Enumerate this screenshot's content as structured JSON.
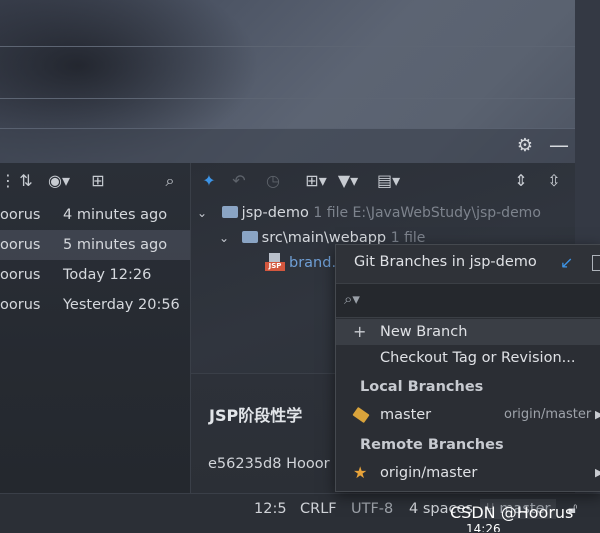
{
  "log": {
    "rows": [
      {
        "author": "oorus",
        "time": "4 minutes ago",
        "selected": false
      },
      {
        "author": "oorus",
        "time": "5 minutes ago",
        "selected": true
      },
      {
        "author": "oorus",
        "time": "Today 12:26",
        "selected": false
      },
      {
        "author": "oorus",
        "time": "Yesterday 20:56",
        "selected": false
      }
    ]
  },
  "changes": {
    "project": "jsp-demo",
    "project_meta": "1 file  E:\\JavaWebStudy\\jsp-demo",
    "folder": "src\\main\\webapp",
    "folder_meta": "1 file",
    "file": "brand.",
    "commit_title": "JSP阶段性学",
    "commit_hash": "e56235d8 Hooor"
  },
  "popup": {
    "title": "Git Branches in jsp-demo",
    "search_placeholder": "",
    "new_branch": "New Branch",
    "checkout": "Checkout Tag or Revision...",
    "local_header": "Local Branches",
    "local_branch": "master",
    "local_remote": "origin/master",
    "remote_header": "Remote Branches",
    "remote_branch": "origin/master"
  },
  "status": {
    "position": "12:5",
    "line_sep": "CRLF",
    "encoding": "UTF-8",
    "indent": "4 spaces",
    "branch": "master"
  },
  "watermark": "CSDN @Hoorus",
  "clock": "14:26",
  "colors": {
    "accent_blue": "#3d94e6",
    "jsp_tag": "#d3573e",
    "tag_gold": "#d9a33b",
    "star": "#e8a33a"
  }
}
